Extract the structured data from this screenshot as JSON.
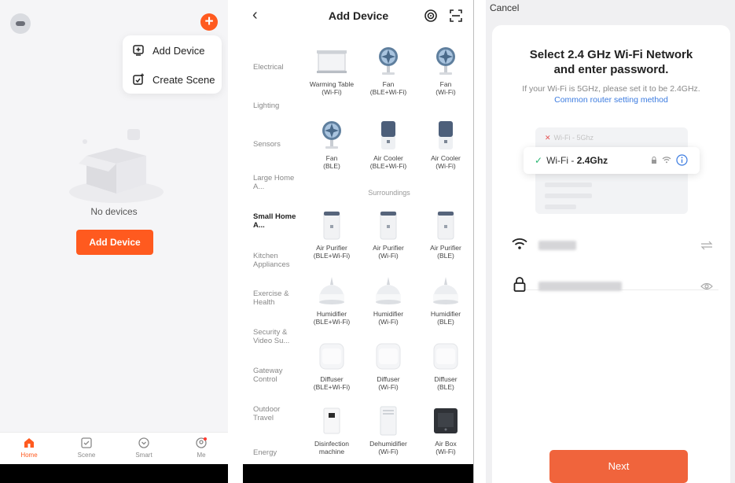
{
  "home": {
    "popup": {
      "add_device": "Add Device",
      "create_scene": "Create Scene"
    },
    "empty_text": "No devices",
    "add_device_button": "Add Device",
    "tabs": [
      {
        "label": "Home",
        "icon": "home-icon"
      },
      {
        "label": "Scene",
        "icon": "scene-icon"
      },
      {
        "label": "Smart",
        "icon": "smart-icon"
      },
      {
        "label": "Me",
        "icon": "me-icon"
      }
    ],
    "accent_color": "#ff5a1f"
  },
  "add_device": {
    "title": "Add Device",
    "categories": [
      "Electrical",
      "Lighting",
      "Sensors",
      "Large Home A...",
      "Small Home A...",
      "Kitchen Appliances",
      "Exercise & Health",
      "Security & Video Su...",
      "Gateway Control",
      "Outdoor Travel",
      "Energy"
    ],
    "active_category": "Small Home A...",
    "section_label": "Surroundings",
    "devices": [
      {
        "name": "Warming Table",
        "sub": "(Wi-Fi)"
      },
      {
        "name": "Fan",
        "sub": "(BLE+Wi-Fi)"
      },
      {
        "name": "Fan",
        "sub": "(Wi-Fi)"
      },
      {
        "name": "Fan",
        "sub": "(BLE)"
      },
      {
        "name": "Air Cooler",
        "sub": "(BLE+Wi-Fi)"
      },
      {
        "name": "Air Cooler",
        "sub": "(Wi-Fi)"
      },
      {
        "name": "Air Purifier",
        "sub": "(BLE+Wi-Fi)"
      },
      {
        "name": "Air Purifier",
        "sub": "(Wi-Fi)"
      },
      {
        "name": "Air Purifier",
        "sub": "(BLE)"
      },
      {
        "name": "Humidifier",
        "sub": "(BLE+Wi-Fi)"
      },
      {
        "name": "Humidifier",
        "sub": "(Wi-Fi)"
      },
      {
        "name": "Humidifier",
        "sub": "(BLE)"
      },
      {
        "name": "Diffuser",
        "sub": "(BLE+Wi-Fi)"
      },
      {
        "name": "Diffuser",
        "sub": "(Wi-Fi)"
      },
      {
        "name": "Diffuser",
        "sub": "(BLE)"
      },
      {
        "name": "Disinfection",
        "sub": "machine"
      },
      {
        "name": "Dehumidifier",
        "sub": "(Wi-Fi)"
      },
      {
        "name": "Air Box",
        "sub": "(Wi-Fi)"
      }
    ]
  },
  "wifi": {
    "cancel": "Cancel",
    "title_line1": "Select 2.4 GHz Wi-Fi Network",
    "title_line2": "and enter password.",
    "hint": "If your Wi-Fi is 5GHz, please set it to be 2.4GHz.",
    "link": "Common router setting method",
    "network_5g_prefix": "Wi-Fi - ",
    "network_5g_band": "5Ghz",
    "network_24_prefix": "Wi-Fi - ",
    "network_24_band": "2.4Ghz",
    "next_button": "Next",
    "button_color": "#f0643c"
  }
}
